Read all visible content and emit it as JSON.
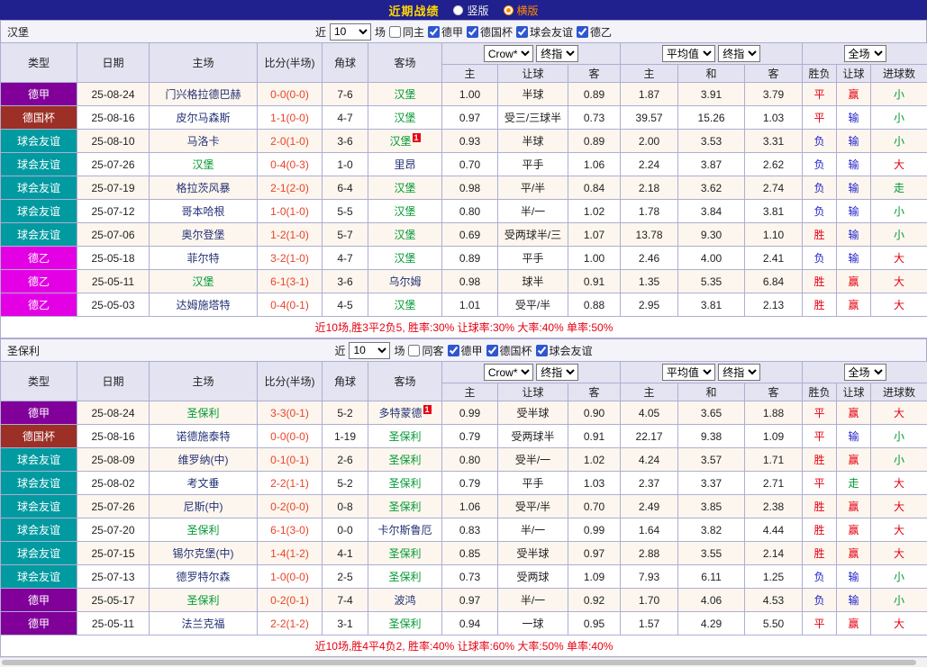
{
  "topbar": {
    "title": "近期战绩",
    "options": [
      {
        "label": "竖版",
        "selected": false
      },
      {
        "label": "横版",
        "selected": true
      }
    ]
  },
  "colors": {
    "topbar_bg": "#20208e",
    "title": "#ffd700",
    "selected_radio": "#ff8a00",
    "leagues": {
      "德甲": "#800099",
      "德国杯": "#9c2f26",
      "球会友谊": "#009aa0",
      "德乙": "#e400e4"
    },
    "results": {
      "胜": "#e60012",
      "平": "#e60012",
      "负": "#2222cc",
      "赢": "#e60012",
      "输": "#2222cc",
      "走": "#009933",
      "大": "#e60012",
      "小": "#009933"
    },
    "self_team": "#009933",
    "opponent": "#253276",
    "score": "#e8432a",
    "summary": "#e60012"
  },
  "columns": {
    "main": [
      "类型",
      "日期",
      "主场",
      "比分(半场)",
      "角球",
      "客场"
    ],
    "sub": [
      "主",
      "让球",
      "客",
      "主",
      "和",
      "客",
      "胜负",
      "让球",
      "进球数"
    ]
  },
  "sections": [
    {
      "team": "汉堡",
      "filter": {
        "prefix": "近",
        "count": "10",
        "suffix": "场",
        "same": "同主",
        "same_checked": false,
        "leagues": [
          {
            "label": "德甲",
            "checked": true
          },
          {
            "label": "德国杯",
            "checked": true
          },
          {
            "label": "球会友谊",
            "checked": true
          },
          {
            "label": "德乙",
            "checked": true
          }
        ]
      },
      "selects": [
        "Crow*",
        "终指",
        "平均值",
        "终指",
        "全场"
      ],
      "rows": [
        {
          "league": "德甲",
          "date": "25-08-24",
          "home": "门兴格拉德巴赫",
          "home_self": false,
          "home_card": 0,
          "score": "0-0(0-0)",
          "corner": "7-6",
          "away": "汉堡",
          "away_self": true,
          "away_card": 0,
          "odds": [
            "1.00",
            "半球",
            "0.89"
          ],
          "avg": [
            "1.87",
            "3.91",
            "3.79"
          ],
          "results": [
            "平",
            "赢",
            "小"
          ]
        },
        {
          "league": "德国杯",
          "date": "25-08-16",
          "home": "皮尔马森斯",
          "home_self": false,
          "home_card": 0,
          "score": "1-1(0-0)",
          "corner": "4-7",
          "away": "汉堡",
          "away_self": true,
          "away_card": 0,
          "odds": [
            "0.97",
            "受三/三球半",
            "0.73"
          ],
          "avg": [
            "39.57",
            "15.26",
            "1.03"
          ],
          "results": [
            "平",
            "输",
            "小"
          ]
        },
        {
          "league": "球会友谊",
          "date": "25-08-10",
          "home": "马洛卡",
          "home_self": false,
          "home_card": 0,
          "score": "2-0(1-0)",
          "corner": "3-6",
          "away": "汉堡",
          "away_self": true,
          "away_card": 1,
          "odds": [
            "0.93",
            "半球",
            "0.89"
          ],
          "avg": [
            "2.00",
            "3.53",
            "3.31"
          ],
          "results": [
            "负",
            "输",
            "小"
          ]
        },
        {
          "league": "球会友谊",
          "date": "25-07-26",
          "home": "汉堡",
          "home_self": true,
          "home_card": 0,
          "score": "0-4(0-3)",
          "corner": "1-0",
          "away": "里昂",
          "away_self": false,
          "away_card": 0,
          "odds": [
            "0.70",
            "平手",
            "1.06"
          ],
          "avg": [
            "2.24",
            "3.87",
            "2.62"
          ],
          "results": [
            "负",
            "输",
            "大"
          ]
        },
        {
          "league": "球会友谊",
          "date": "25-07-19",
          "home": "格拉茨风暴",
          "home_self": false,
          "home_card": 0,
          "score": "2-1(2-0)",
          "corner": "6-4",
          "away": "汉堡",
          "away_self": true,
          "away_card": 0,
          "odds": [
            "0.98",
            "平/半",
            "0.84"
          ],
          "avg": [
            "2.18",
            "3.62",
            "2.74"
          ],
          "results": [
            "负",
            "输",
            "走"
          ]
        },
        {
          "league": "球会友谊",
          "date": "25-07-12",
          "home": "哥本哈根",
          "home_self": false,
          "home_card": 0,
          "score": "1-0(1-0)",
          "corner": "5-5",
          "away": "汉堡",
          "away_self": true,
          "away_card": 0,
          "odds": [
            "0.80",
            "半/一",
            "1.02"
          ],
          "avg": [
            "1.78",
            "3.84",
            "3.81"
          ],
          "results": [
            "负",
            "输",
            "小"
          ]
        },
        {
          "league": "球会友谊",
          "date": "25-07-06",
          "home": "奥尔登堡",
          "home_self": false,
          "home_card": 0,
          "score": "1-2(1-0)",
          "corner": "5-7",
          "away": "汉堡",
          "away_self": true,
          "away_card": 0,
          "odds": [
            "0.69",
            "受两球半/三",
            "1.07"
          ],
          "avg": [
            "13.78",
            "9.30",
            "1.10"
          ],
          "results": [
            "胜",
            "输",
            "小"
          ]
        },
        {
          "league": "德乙",
          "date": "25-05-18",
          "home": "菲尔特",
          "home_self": false,
          "home_card": 0,
          "score": "3-2(1-0)",
          "corner": "4-7",
          "away": "汉堡",
          "away_self": true,
          "away_card": 0,
          "odds": [
            "0.89",
            "平手",
            "1.00"
          ],
          "avg": [
            "2.46",
            "4.00",
            "2.41"
          ],
          "results": [
            "负",
            "输",
            "大"
          ]
        },
        {
          "league": "德乙",
          "date": "25-05-11",
          "home": "汉堡",
          "home_self": true,
          "home_card": 0,
          "score": "6-1(3-1)",
          "corner": "3-6",
          "away": "乌尔姆",
          "away_self": false,
          "away_card": 0,
          "odds": [
            "0.98",
            "球半",
            "0.91"
          ],
          "avg": [
            "1.35",
            "5.35",
            "6.84"
          ],
          "results": [
            "胜",
            "赢",
            "大"
          ]
        },
        {
          "league": "德乙",
          "date": "25-05-03",
          "home": "达姆施塔特",
          "home_self": false,
          "home_card": 0,
          "score": "0-4(0-1)",
          "corner": "4-5",
          "away": "汉堡",
          "away_self": true,
          "away_card": 0,
          "odds": [
            "1.01",
            "受平/半",
            "0.88"
          ],
          "avg": [
            "2.95",
            "3.81",
            "2.13"
          ],
          "results": [
            "胜",
            "赢",
            "大"
          ]
        }
      ],
      "summary": "近10场,胜3平2负5, 胜率:30% 让球率:30% 大率:40% 单率:50%"
    },
    {
      "team": "圣保利",
      "filter": {
        "prefix": "近",
        "count": "10",
        "suffix": "场",
        "same": "同客",
        "same_checked": false,
        "leagues": [
          {
            "label": "德甲",
            "checked": true
          },
          {
            "label": "德国杯",
            "checked": true
          },
          {
            "label": "球会友谊",
            "checked": true
          }
        ]
      },
      "selects": [
        "Crow*",
        "终指",
        "平均值",
        "终指",
        "全场"
      ],
      "rows": [
        {
          "league": "德甲",
          "date": "25-08-24",
          "home": "圣保利",
          "home_self": true,
          "home_card": 0,
          "score": "3-3(0-1)",
          "corner": "5-2",
          "away": "多特蒙德",
          "away_self": false,
          "away_card": 1,
          "odds": [
            "0.99",
            "受半球",
            "0.90"
          ],
          "avg": [
            "4.05",
            "3.65",
            "1.88"
          ],
          "results": [
            "平",
            "赢",
            "大"
          ]
        },
        {
          "league": "德国杯",
          "date": "25-08-16",
          "home": "诺德施泰特",
          "home_self": false,
          "home_card": 0,
          "score": "0-0(0-0)",
          "corner": "1-19",
          "away": "圣保利",
          "away_self": true,
          "away_card": 0,
          "odds": [
            "0.79",
            "受两球半",
            "0.91"
          ],
          "avg": [
            "22.17",
            "9.38",
            "1.09"
          ],
          "results": [
            "平",
            "输",
            "小"
          ]
        },
        {
          "league": "球会友谊",
          "date": "25-08-09",
          "home": "维罗纳(中)",
          "home_self": false,
          "home_card": 0,
          "score": "0-1(0-1)",
          "corner": "2-6",
          "away": "圣保利",
          "away_self": true,
          "away_card": 0,
          "odds": [
            "0.80",
            "受半/一",
            "1.02"
          ],
          "avg": [
            "4.24",
            "3.57",
            "1.71"
          ],
          "results": [
            "胜",
            "赢",
            "小"
          ]
        },
        {
          "league": "球会友谊",
          "date": "25-08-02",
          "home": "考文垂",
          "home_self": false,
          "home_card": 0,
          "score": "2-2(1-1)",
          "corner": "5-2",
          "away": "圣保利",
          "away_self": true,
          "away_card": 0,
          "odds": [
            "0.79",
            "平手",
            "1.03"
          ],
          "avg": [
            "2.37",
            "3.37",
            "2.71"
          ],
          "results": [
            "平",
            "走",
            "大"
          ]
        },
        {
          "league": "球会友谊",
          "date": "25-07-26",
          "home": "尼斯(中)",
          "home_self": false,
          "home_card": 0,
          "score": "0-2(0-0)",
          "corner": "0-8",
          "away": "圣保利",
          "away_self": true,
          "away_card": 0,
          "odds": [
            "1.06",
            "受平/半",
            "0.70"
          ],
          "avg": [
            "2.49",
            "3.85",
            "2.38"
          ],
          "results": [
            "胜",
            "赢",
            "大"
          ]
        },
        {
          "league": "球会友谊",
          "date": "25-07-20",
          "home": "圣保利",
          "home_self": true,
          "home_card": 0,
          "score": "6-1(3-0)",
          "corner": "0-0",
          "away": "卡尔斯鲁厄",
          "away_self": false,
          "away_card": 0,
          "odds": [
            "0.83",
            "半/一",
            "0.99"
          ],
          "avg": [
            "1.64",
            "3.82",
            "4.44"
          ],
          "results": [
            "胜",
            "赢",
            "大"
          ]
        },
        {
          "league": "球会友谊",
          "date": "25-07-15",
          "home": "锡尔克堡(中)",
          "home_self": false,
          "home_card": 0,
          "score": "1-4(1-2)",
          "corner": "4-1",
          "away": "圣保利",
          "away_self": true,
          "away_card": 0,
          "odds": [
            "0.85",
            "受半球",
            "0.97"
          ],
          "avg": [
            "2.88",
            "3.55",
            "2.14"
          ],
          "results": [
            "胜",
            "赢",
            "大"
          ]
        },
        {
          "league": "球会友谊",
          "date": "25-07-13",
          "home": "德罗特尔森",
          "home_self": false,
          "home_card": 0,
          "score": "1-0(0-0)",
          "corner": "2-5",
          "away": "圣保利",
          "away_self": true,
          "away_card": 0,
          "odds": [
            "0.73",
            "受两球",
            "1.09"
          ],
          "avg": [
            "7.93",
            "6.11",
            "1.25"
          ],
          "results": [
            "负",
            "输",
            "小"
          ]
        },
        {
          "league": "德甲",
          "date": "25-05-17",
          "home": "圣保利",
          "home_self": true,
          "home_card": 0,
          "score": "0-2(0-1)",
          "corner": "7-4",
          "away": "波鸿",
          "away_self": false,
          "away_card": 0,
          "odds": [
            "0.97",
            "半/一",
            "0.92"
          ],
          "avg": [
            "1.70",
            "4.06",
            "4.53"
          ],
          "results": [
            "负",
            "输",
            "小"
          ]
        },
        {
          "league": "德甲",
          "date": "25-05-11",
          "home": "法兰克福",
          "home_self": false,
          "home_card": 0,
          "score": "2-2(1-2)",
          "corner": "3-1",
          "away": "圣保利",
          "away_self": true,
          "away_card": 0,
          "odds": [
            "0.94",
            "一球",
            "0.95"
          ],
          "avg": [
            "1.57",
            "4.29",
            "5.50"
          ],
          "results": [
            "平",
            "赢",
            "大"
          ]
        }
      ],
      "summary": "近10场,胜4平4负2, 胜率:40% 让球率:60% 大率:50% 单率:40%"
    }
  ]
}
